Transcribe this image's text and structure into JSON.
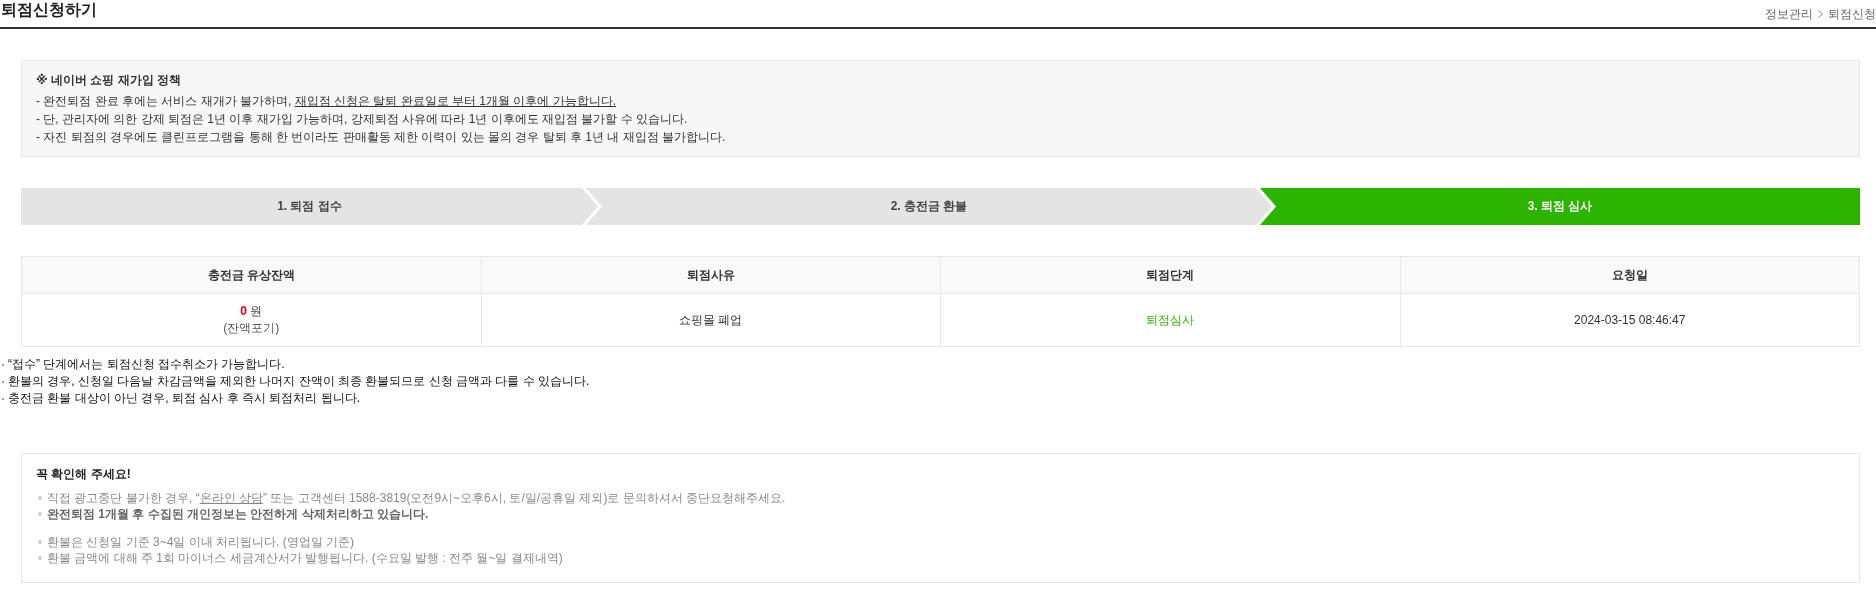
{
  "header": {
    "title": "퇴점신청하기",
    "breadcrumb": [
      {
        "label": "정보관리"
      },
      {
        "label": "퇴점신청"
      }
    ]
  },
  "policy_notice": {
    "title": "※ 네이버 쇼핑 재가입 정책",
    "lines": [
      {
        "text": "- 완전퇴점 완료 후에는 서비스 재개가 불가하며, ",
        "underlined": "재입점 신청은 탈퇴 완료일로 부터 1개월 이후에 가능합니다."
      },
      {
        "text": "- 단, 관리자에 의한 강제 퇴점은 1년 이후 재가입 가능하며, 강제퇴점 사유에 따라 1년 이후에도 재입점 불가할 수 있습니다."
      },
      {
        "text": "- 자진 퇴점의 경우에도 클린프로그램을 통해 한 번이라도 판매활동 제한 이력이 있는 몰의 경우 탈퇴 후 1년 내 재입점 불가합니다."
      }
    ]
  },
  "steps": [
    {
      "label": "1. 퇴점 접수",
      "selected": false
    },
    {
      "label": "2. 충전금 환불",
      "selected": false
    },
    {
      "label": "3. 퇴점 심사",
      "selected": true
    }
  ],
  "table": {
    "columns": [
      "충전금 유상잔액",
      "퇴점사유",
      "퇴점단계",
      "요청일"
    ],
    "rows": [
      {
        "balance": {
          "amount": "0",
          "unit": "원",
          "note": "(잔액포기)"
        },
        "reason": "쇼핑몰 폐업",
        "stage": "퇴점심사",
        "requested": "2024-03-15 08:46:47"
      }
    ]
  },
  "notes": [
    "“접수” 단계에서는 퇴점신청 접수취소가 가능합니다.",
    "환불의 경우, 신청일 다음날 차감금액을 제외한 나머지 잔액이 최종 환불되므로 신청 금액과 다를 수 있습니다.",
    "충전금 환불 대상이 아닌 경우, 퇴점 심사 후 즉시 퇴점처리 됩니다."
  ],
  "check_notice": {
    "title": "꼭 확인해 주세요!",
    "groups": [
      {
        "items": [
          {
            "kind": "link-sentence",
            "before": "직접 광고중단 불가한 경우, “",
            "link": "온라인 상담",
            "after": "” 또는 고객센터 1588-3819(오전9시~오후6시, 토/일/공휴일 제외)로 문의하셔서 중단요청해주세요.",
            "bold": false
          },
          {
            "kind": "plain",
            "text": "완전퇴점 1개월 후 수집된 개인정보는 안전하게 삭제처리하고 있습니다.",
            "bold": true
          }
        ]
      },
      {
        "items": [
          {
            "kind": "plain",
            "text": "환불은 신청일 기준 3~4일 이내 처리됩니다. (영업일 기준)",
            "bold": false
          },
          {
            "kind": "plain",
            "text": "환불 금액에 대해 주 1회 마이너스 세금계산서가 발행됩니다. (수요일 발행 : 전주 월~일 결제내역)",
            "bold": false
          }
        ]
      }
    ]
  }
}
